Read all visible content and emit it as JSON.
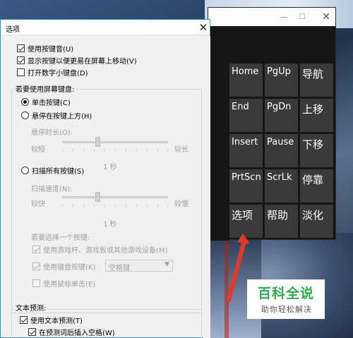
{
  "dialog": {
    "title": "选项",
    "close_glyph": "✕",
    "options": {
      "use_click_sound": "使用按键音(U)",
      "show_keys_move": "显示按键以便更易在屏幕上移动(V)",
      "numeric_keypad": "打开数字小键盘(D)"
    },
    "usage_group": {
      "title": "若要使用屏幕键盘:",
      "click_keys": "单击按键(C)",
      "hover_keys": "悬停在按键上方(H)",
      "hover_duration_label": "悬停时长(O):",
      "hover_short": "较短",
      "hover_long": "较长",
      "hover_value": "1 秒",
      "scan_keys": "扫描所有按键(S)",
      "scan_speed_label": "扫描速度(N):",
      "scan_fast": "较快",
      "scan_slow": "较慢",
      "scan_value": "1 秒",
      "select_key_label": "若要选择一个按键:",
      "use_joystick": "使用游戏杆、游戏板或其他游戏设备(M)",
      "use_keyboard_key": "使用键盘按键(K)",
      "keyboard_key_value": "空格键",
      "use_mouse_click": "使用鼠标单击(E)"
    },
    "text_prediction": {
      "title": "文本预测:",
      "use_prediction": "使用文本预测(T)",
      "insert_space": "在预测词后插入空格(W)"
    }
  },
  "osk": {
    "window_controls": {
      "minimize": "—",
      "maximize": "☐",
      "close": "✕"
    },
    "keys": [
      [
        "Home",
        "PgUp",
        "导航"
      ],
      [
        "End",
        "PgDn",
        "上移"
      ],
      [
        "Insert",
        "Pause",
        "下移"
      ],
      [
        "PrtScn",
        "ScrLk",
        "停靠"
      ],
      [
        "选项",
        "帮助",
        "淡化"
      ]
    ]
  },
  "watermark": {
    "main": "百科全说",
    "sub": "助你轻松解决"
  },
  "colors": {
    "accent_border": "#3a8fc7",
    "osk_key": "#3a3a3a",
    "watermark_green": "#2fa84f",
    "arrow_red": "#e0392b"
  }
}
